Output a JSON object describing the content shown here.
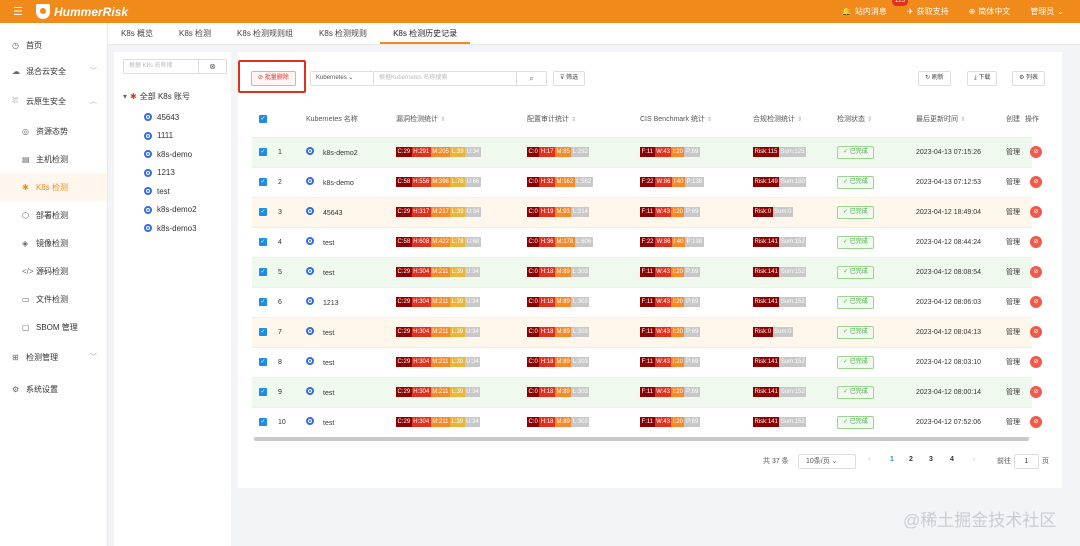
{
  "brand": {
    "name": "HummerRisk"
  },
  "header": {
    "messages_label": "站内消息",
    "messages_count": "123",
    "support_label": "获取支持",
    "language_label": "简体中文",
    "user_label": "管理员"
  },
  "sidebar": {
    "items": [
      {
        "label": "首页",
        "icon": "home-icon"
      },
      {
        "label": "混合云安全",
        "icon": "cloud-icon",
        "chevron": "﹀"
      },
      {
        "label": "云原生安全",
        "icon": "cloud-native-icon",
        "chevron": "︿"
      },
      {
        "label": "资源态势",
        "icon": "radar-icon",
        "sub": true
      },
      {
        "label": "主机检测",
        "icon": "host-icon",
        "sub": true
      },
      {
        "label": "K8s 检测",
        "icon": "k8s-icon",
        "sub": true,
        "active": true
      },
      {
        "label": "部署检测",
        "icon": "deploy-icon",
        "sub": true
      },
      {
        "label": "镜像检测",
        "icon": "image-icon",
        "sub": true
      },
      {
        "label": "源码检测",
        "icon": "code-icon",
        "sub": true
      },
      {
        "label": "文件检测",
        "icon": "file-icon",
        "sub": true
      },
      {
        "label": "SBOM 管理",
        "icon": "sbom-icon",
        "sub": true
      },
      {
        "label": "检测管理",
        "icon": "manage-icon",
        "chevron": "﹀"
      },
      {
        "label": "系统设置",
        "icon": "settings-icon"
      }
    ]
  },
  "tabs": [
    "K8s 概览",
    "K8s 检测",
    "K8s 检测规则组",
    "K8s 检测规则",
    "K8s 检测历史记录"
  ],
  "tree": {
    "search_placeholder": "根据 K8s 名称搜",
    "root_label": "全部 K8s 账号",
    "nodes": [
      "45643",
      "1111",
      "k8s-demo",
      "1213",
      "test",
      "k8s-demo2",
      "k8s-demo3"
    ]
  },
  "toolbar": {
    "batch_delete": "批量删除",
    "filter_select": "Kubernetes",
    "search_placeholder": "根据Kubernetes 名称搜索",
    "filter_label": "筛选",
    "refresh_label": "刷新",
    "download_label": "下载",
    "columns_label": "列表"
  },
  "table": {
    "headers": {
      "name": "Kubernetes 名称",
      "vuln": "漏洞检测统计",
      "config": "配置审计统计",
      "cis": "CIS Benchmark 统计",
      "compliance": "合规检测统计",
      "status": "检测状态",
      "updated": "最后更新时间",
      "creator": "创建",
      "op": "操作"
    },
    "rows": [
      {
        "no": "1",
        "name": "k8s-demo2",
        "vuln": [
          "C:29",
          "H:291",
          "M:205",
          "L:39",
          "U:34"
        ],
        "config": [
          "C:0",
          "H:17",
          "M:85",
          "L:292"
        ],
        "cis": [
          "F:11",
          "W:43",
          "I:20",
          "P:69"
        ],
        "comp": [
          "Risk:115",
          "Sum:125"
        ],
        "status": "已完成",
        "time": "2023-04-13 07:15:26",
        "creator": "管理",
        "bg": "g"
      },
      {
        "no": "2",
        "name": "k8s-demo",
        "vuln": [
          "C:58",
          "H:556",
          "M:398",
          "L:78",
          "U:66"
        ],
        "config": [
          "C:0",
          "H:32",
          "M:162",
          "L:562"
        ],
        "cis": [
          "F:22",
          "W:86",
          "I:40",
          "P:138"
        ],
        "comp": [
          "Risk:149",
          "Sum:180"
        ],
        "status": "已完成",
        "time": "2023-04-13 07:12:53",
        "creator": "管理",
        "bg": "w"
      },
      {
        "no": "3",
        "name": "45643",
        "vuln": [
          "C:29",
          "H:317",
          "M:217",
          "L:39",
          "U:34"
        ],
        "config": [
          "C:0",
          "H:19",
          "M:93",
          "L:314"
        ],
        "cis": [
          "F:11",
          "W:43",
          "I:20",
          "P:69"
        ],
        "comp": [
          "Risk:0",
          "Sum:0"
        ],
        "status": "已完成",
        "time": "2023-04-12 18:49:04",
        "creator": "管理",
        "bg": "o"
      },
      {
        "no": "4",
        "name": "test",
        "vuln": [
          "C:58",
          "H:608",
          "M:422",
          "L:78",
          "U:68"
        ],
        "config": [
          "C:0",
          "H:36",
          "M:178",
          "L:606"
        ],
        "cis": [
          "F:22",
          "W:86",
          "I:40",
          "P:138"
        ],
        "comp": [
          "Risk:141",
          "Sum:152"
        ],
        "status": "已完成",
        "time": "2023-04-12 08:44:24",
        "creator": "管理",
        "bg": "w"
      },
      {
        "no": "5",
        "name": "test",
        "vuln": [
          "C:29",
          "H:304",
          "M:211",
          "L:39",
          "U:34"
        ],
        "config": [
          "C:0",
          "H:18",
          "M:89",
          "L:303"
        ],
        "cis": [
          "F:11",
          "W:43",
          "I:20",
          "P:69"
        ],
        "comp": [
          "Risk:141",
          "Sum:152"
        ],
        "status": "已完成",
        "time": "2023-04-12 08:08:54",
        "creator": "管理",
        "bg": "g"
      },
      {
        "no": "6",
        "name": "1213",
        "vuln": [
          "C:29",
          "H:304",
          "M:211",
          "L:39",
          "U:34"
        ],
        "config": [
          "C:0",
          "H:18",
          "M:89",
          "L:303"
        ],
        "cis": [
          "F:11",
          "W:43",
          "I:20",
          "P:69"
        ],
        "comp": [
          "Risk:141",
          "Sum:152"
        ],
        "status": "已完成",
        "time": "2023-04-12 08:06:03",
        "creator": "管理",
        "bg": "w"
      },
      {
        "no": "7",
        "name": "test",
        "vuln": [
          "C:29",
          "H:304",
          "M:211",
          "L:39",
          "U:34"
        ],
        "config": [
          "C:0",
          "H:18",
          "M:89",
          "L:303"
        ],
        "cis": [
          "F:11",
          "W:43",
          "I:20",
          "P:69"
        ],
        "comp": [
          "Risk:0",
          "Sum:0"
        ],
        "status": "已完成",
        "time": "2023-04-12 08:04:13",
        "creator": "管理",
        "bg": "o"
      },
      {
        "no": "8",
        "name": "test",
        "vuln": [
          "C:29",
          "H:304",
          "M:211",
          "L:39",
          "U:34"
        ],
        "config": [
          "C:0",
          "H:18",
          "M:89",
          "L:303"
        ],
        "cis": [
          "F:11",
          "W:43",
          "I:20",
          "P:69"
        ],
        "comp": [
          "Risk:141",
          "Sum:152"
        ],
        "status": "已完成",
        "time": "2023-04-12 08:03:10",
        "creator": "管理",
        "bg": "w"
      },
      {
        "no": "9",
        "name": "test",
        "vuln": [
          "C:29",
          "H:304",
          "M:211",
          "L:39",
          "U:34"
        ],
        "config": [
          "C:0",
          "H:18",
          "M:89",
          "L:303"
        ],
        "cis": [
          "F:11",
          "W:43",
          "I:20",
          "P:69"
        ],
        "comp": [
          "Risk:141",
          "Sum:152"
        ],
        "status": "已完成",
        "time": "2023-04-12 08:00:14",
        "creator": "管理",
        "bg": "g"
      },
      {
        "no": "10",
        "name": "test",
        "vuln": [
          "C:29",
          "H:304",
          "M:211",
          "L:39",
          "U:34"
        ],
        "config": [
          "C:0",
          "H:18",
          "M:89",
          "L:303"
        ],
        "cis": [
          "F:11",
          "W:43",
          "I:20",
          "P:69"
        ],
        "comp": [
          "Risk:141",
          "Sum:152"
        ],
        "status": "已完成",
        "time": "2023-04-12 07:52:06",
        "creator": "管理",
        "bg": "w"
      }
    ]
  },
  "pagination": {
    "total": "共 37 条",
    "page_size": "10条/页",
    "pages": [
      "1",
      "2",
      "3",
      "4"
    ],
    "current": "1",
    "goto_label": "前往",
    "goto_value": "1",
    "page_unit": "页"
  },
  "watermark": "@稀土掘金技术社区",
  "colors": {
    "brand": "#ef8a1b",
    "critical": "#8b0000",
    "high": "#e0311f",
    "medium": "#f58a2a",
    "low": "#e9b53a",
    "unknown": "#c8c8c8",
    "success": "#3aa936",
    "primary": "#1e8ce6"
  }
}
